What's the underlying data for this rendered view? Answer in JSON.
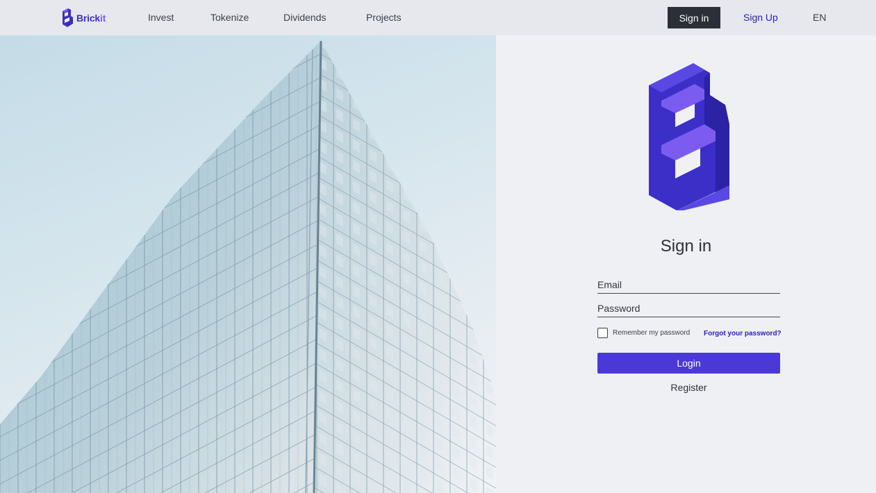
{
  "header": {
    "logo": {
      "text_a": "Brick",
      "text_b": "it",
      "icon": "brickit-logo-icon"
    },
    "nav": [
      "Invest",
      "Tokenize",
      "Dividends",
      "Projects"
    ],
    "sign_in_label": "Sign in",
    "sign_up_label": "Sign Up",
    "language": "EN"
  },
  "hero": {
    "image": "glass-building-photo"
  },
  "login": {
    "logo_icon": "brickit-logo-icon",
    "title": "Sign in",
    "email_placeholder": "Email",
    "password_placeholder": "Password",
    "remember_label": "Remember my password",
    "remember_checked": false,
    "forgot_label": "Forgot your password?",
    "login_label": "Login",
    "register_label": "Register"
  },
  "colors": {
    "brand": "#4a39d6",
    "brand_dark": "#2b20b8",
    "brand_light": "#7c5cf0",
    "header_bg": "#e6e8ee",
    "dark_button": "#2b2f38"
  }
}
